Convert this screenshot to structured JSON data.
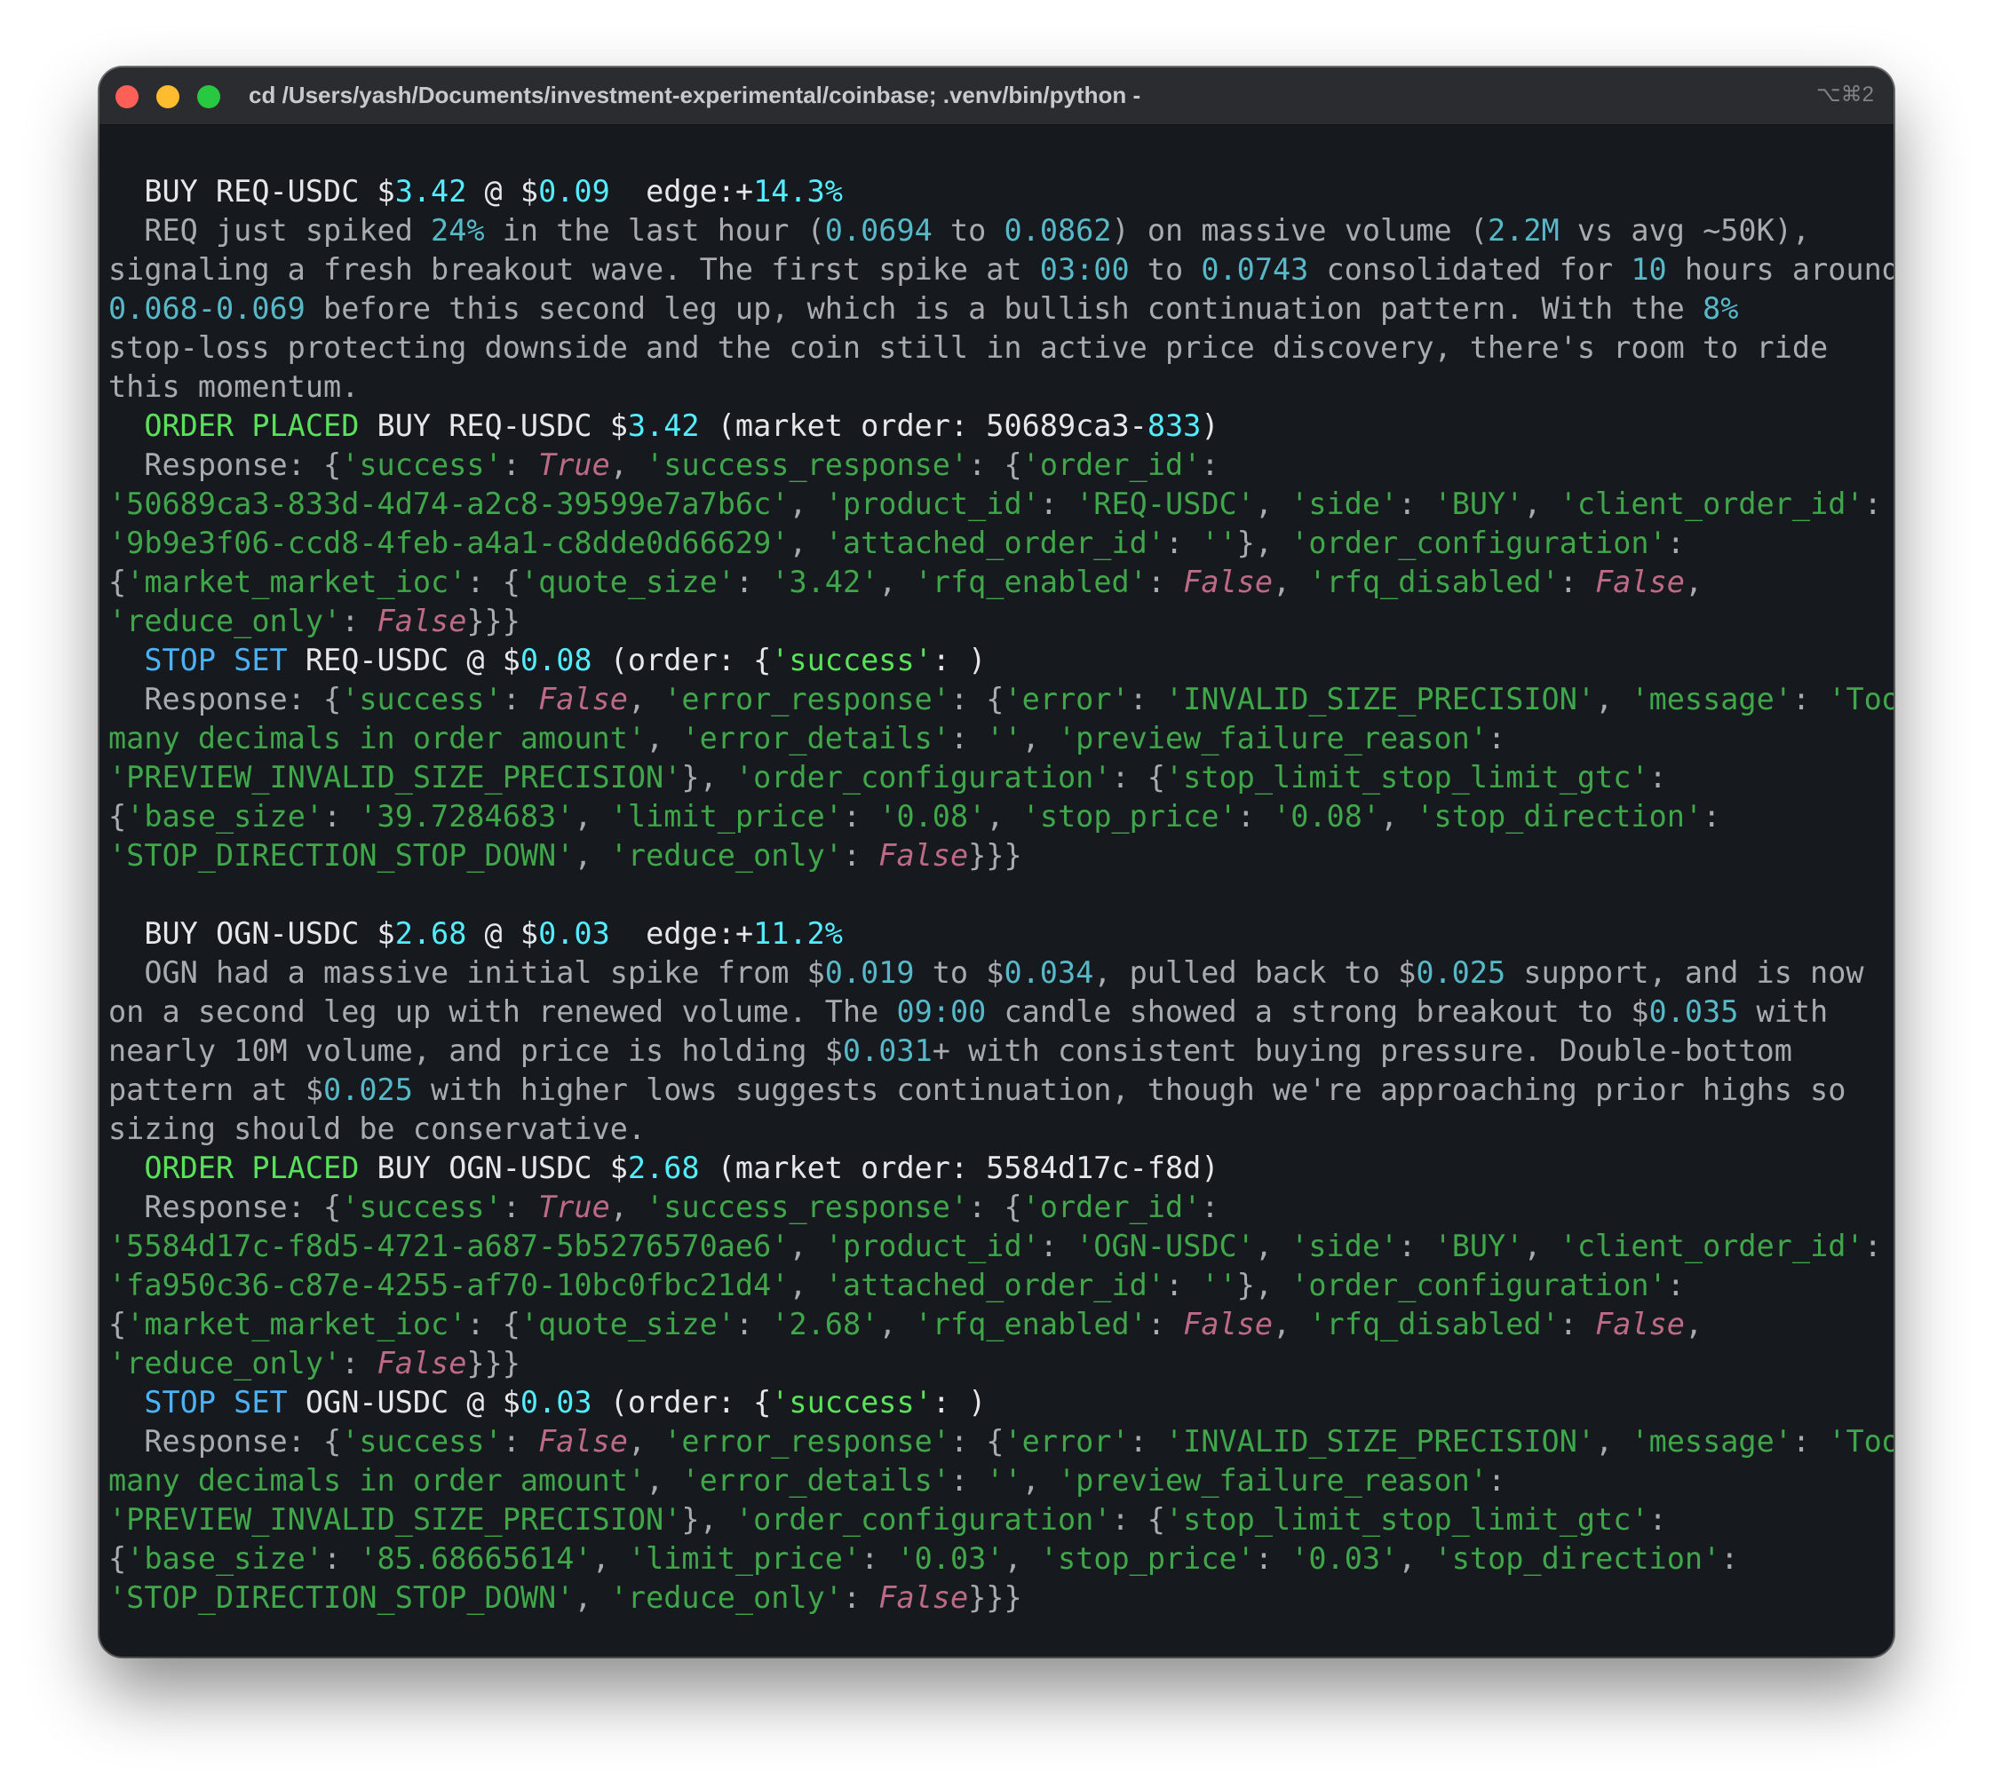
{
  "titlebar": {
    "title": "cd /Users/yash/Documents/investment-experimental/coinbase; .venv/bin/python -",
    "shortcut": "⌥⌘2"
  },
  "colors": {
    "terminal_bg": "#16191e",
    "text_gray": "#a8abb0",
    "text_white": "#e6e7ea",
    "cyan_bright": "#54ecff",
    "cyan_teal": "#57b9c8",
    "green_bright": "#5be05b",
    "string_green": "#3fa64a",
    "keyword_pink": "#bd6a84",
    "stop_blue": "#4bb3f5"
  },
  "output": [
    [
      {
        "t": "  BUY REQ-USDC $",
        "c": "w"
      },
      {
        "t": "3.42",
        "c": "c"
      },
      {
        "t": " @ $",
        "c": "w"
      },
      {
        "t": "0.09",
        "c": "c"
      },
      {
        "t": "  edge:+",
        "c": "w"
      },
      {
        "t": "14.3%",
        "c": "c"
      }
    ],
    [
      {
        "t": "  REQ just spiked ",
        "c": "dim"
      },
      {
        "t": "24%",
        "c": "tc"
      },
      {
        "t": " in the last hour (",
        "c": "dim"
      },
      {
        "t": "0.0694",
        "c": "tc"
      },
      {
        "t": " to ",
        "c": "dim"
      },
      {
        "t": "0.0862",
        "c": "tc"
      },
      {
        "t": ") on massive volume (",
        "c": "dim"
      },
      {
        "t": "2.2M",
        "c": "tc"
      },
      {
        "t": " vs avg ~50K),",
        "c": "dim"
      }
    ],
    [
      {
        "t": "signaling a fresh breakout wave. The first spike at ",
        "c": "dim"
      },
      {
        "t": "03:00",
        "c": "tc"
      },
      {
        "t": " to ",
        "c": "dim"
      },
      {
        "t": "0.0743",
        "c": "tc"
      },
      {
        "t": " consolidated for ",
        "c": "dim"
      },
      {
        "t": "10",
        "c": "tc"
      },
      {
        "t": " hours around",
        "c": "dim"
      }
    ],
    [
      {
        "t": "0.068-0.069",
        "c": "tc"
      },
      {
        "t": " before this second leg up, which is a bullish continuation pattern. With the ",
        "c": "dim"
      },
      {
        "t": "8%",
        "c": "tc"
      }
    ],
    [
      {
        "t": "stop-loss protecting downside and the coin still in active price discovery, there's room to ride",
        "c": "dim"
      }
    ],
    [
      {
        "t": "this momentum.",
        "c": "dim"
      }
    ],
    [
      {
        "t": "  ORDER PLACED",
        "c": "g"
      },
      {
        "t": " BUY REQ-USDC $",
        "c": "w"
      },
      {
        "t": "3.42",
        "c": "c"
      },
      {
        "t": " (market order: 50689ca3-",
        "c": "w"
      },
      {
        "t": "833",
        "c": "c"
      },
      {
        "t": ")",
        "c": "w"
      }
    ],
    [
      {
        "t": "  Response: {",
        "c": "dim"
      },
      {
        "t": "'success'",
        "c": "sg"
      },
      {
        "t": ": ",
        "c": "dim"
      },
      {
        "t": "True",
        "c": "kw"
      },
      {
        "t": ", ",
        "c": "dim"
      },
      {
        "t": "'success_response'",
        "c": "sg"
      },
      {
        "t": ": {",
        "c": "dim"
      },
      {
        "t": "'order_id'",
        "c": "sg"
      },
      {
        "t": ":",
        "c": "dim"
      }
    ],
    [
      {
        "t": "'50689ca3-833d-4d74-a2c8-39599e7a7b6c'",
        "c": "sg"
      },
      {
        "t": ", ",
        "c": "dim"
      },
      {
        "t": "'product_id'",
        "c": "sg"
      },
      {
        "t": ": ",
        "c": "dim"
      },
      {
        "t": "'REQ-USDC'",
        "c": "sg"
      },
      {
        "t": ", ",
        "c": "dim"
      },
      {
        "t": "'side'",
        "c": "sg"
      },
      {
        "t": ": ",
        "c": "dim"
      },
      {
        "t": "'BUY'",
        "c": "sg"
      },
      {
        "t": ", ",
        "c": "dim"
      },
      {
        "t": "'client_order_id'",
        "c": "sg"
      },
      {
        "t": ":",
        "c": "dim"
      }
    ],
    [
      {
        "t": "'9b9e3f06-ccd8-4feb-a4a1-c8dde0d66629'",
        "c": "sg"
      },
      {
        "t": ", ",
        "c": "dim"
      },
      {
        "t": "'attached_order_id'",
        "c": "sg"
      },
      {
        "t": ": ",
        "c": "dim"
      },
      {
        "t": "''",
        "c": "sg"
      },
      {
        "t": "}, ",
        "c": "dim"
      },
      {
        "t": "'order_configuration'",
        "c": "sg"
      },
      {
        "t": ":",
        "c": "dim"
      }
    ],
    [
      {
        "t": "{",
        "c": "dim"
      },
      {
        "t": "'market_market_ioc'",
        "c": "sg"
      },
      {
        "t": ": {",
        "c": "dim"
      },
      {
        "t": "'quote_size'",
        "c": "sg"
      },
      {
        "t": ": ",
        "c": "dim"
      },
      {
        "t": "'3.42'",
        "c": "sg"
      },
      {
        "t": ", ",
        "c": "dim"
      },
      {
        "t": "'rfq_enabled'",
        "c": "sg"
      },
      {
        "t": ": ",
        "c": "dim"
      },
      {
        "t": "False",
        "c": "kw"
      },
      {
        "t": ", ",
        "c": "dim"
      },
      {
        "t": "'rfq_disabled'",
        "c": "sg"
      },
      {
        "t": ": ",
        "c": "dim"
      },
      {
        "t": "False",
        "c": "kw"
      },
      {
        "t": ",",
        "c": "dim"
      }
    ],
    [
      {
        "t": "'reduce_only'",
        "c": "sg"
      },
      {
        "t": ": ",
        "c": "dim"
      },
      {
        "t": "False",
        "c": "kw"
      },
      {
        "t": "}}}",
        "c": "dim"
      }
    ],
    [
      {
        "t": "  STOP SET",
        "c": "b"
      },
      {
        "t": " REQ-USDC @ $",
        "c": "w"
      },
      {
        "t": "0.08",
        "c": "c"
      },
      {
        "t": " (order: {",
        "c": "w"
      },
      {
        "t": "'success'",
        "c": "g"
      },
      {
        "t": ": )",
        "c": "w"
      }
    ],
    [
      {
        "t": "  Response: {",
        "c": "dim"
      },
      {
        "t": "'success'",
        "c": "sg"
      },
      {
        "t": ": ",
        "c": "dim"
      },
      {
        "t": "False",
        "c": "kw"
      },
      {
        "t": ", ",
        "c": "dim"
      },
      {
        "t": "'error_response'",
        "c": "sg"
      },
      {
        "t": ": {",
        "c": "dim"
      },
      {
        "t": "'error'",
        "c": "sg"
      },
      {
        "t": ": ",
        "c": "dim"
      },
      {
        "t": "'INVALID_SIZE_PRECISION'",
        "c": "sg"
      },
      {
        "t": ", ",
        "c": "dim"
      },
      {
        "t": "'message'",
        "c": "sg"
      },
      {
        "t": ": ",
        "c": "dim"
      },
      {
        "t": "'Too",
        "c": "sg"
      }
    ],
    [
      {
        "t": "many decimals in order amount'",
        "c": "sg"
      },
      {
        "t": ", ",
        "c": "dim"
      },
      {
        "t": "'error_details'",
        "c": "sg"
      },
      {
        "t": ": ",
        "c": "dim"
      },
      {
        "t": "''",
        "c": "sg"
      },
      {
        "t": ", ",
        "c": "dim"
      },
      {
        "t": "'preview_failure_reason'",
        "c": "sg"
      },
      {
        "t": ":",
        "c": "dim"
      }
    ],
    [
      {
        "t": "'PREVIEW_INVALID_SIZE_PRECISION'",
        "c": "sg"
      },
      {
        "t": "}, ",
        "c": "dim"
      },
      {
        "t": "'order_configuration'",
        "c": "sg"
      },
      {
        "t": ": {",
        "c": "dim"
      },
      {
        "t": "'stop_limit_stop_limit_gtc'",
        "c": "sg"
      },
      {
        "t": ":",
        "c": "dim"
      }
    ],
    [
      {
        "t": "{",
        "c": "dim"
      },
      {
        "t": "'base_size'",
        "c": "sg"
      },
      {
        "t": ": ",
        "c": "dim"
      },
      {
        "t": "'39.7284683'",
        "c": "sg"
      },
      {
        "t": ", ",
        "c": "dim"
      },
      {
        "t": "'limit_price'",
        "c": "sg"
      },
      {
        "t": ": ",
        "c": "dim"
      },
      {
        "t": "'0.08'",
        "c": "sg"
      },
      {
        "t": ", ",
        "c": "dim"
      },
      {
        "t": "'stop_price'",
        "c": "sg"
      },
      {
        "t": ": ",
        "c": "dim"
      },
      {
        "t": "'0.08'",
        "c": "sg"
      },
      {
        "t": ", ",
        "c": "dim"
      },
      {
        "t": "'stop_direction'",
        "c": "sg"
      },
      {
        "t": ":",
        "c": "dim"
      }
    ],
    [
      {
        "t": "'STOP_DIRECTION_STOP_DOWN'",
        "c": "sg"
      },
      {
        "t": ", ",
        "c": "dim"
      },
      {
        "t": "'reduce_only'",
        "c": "sg"
      },
      {
        "t": ": ",
        "c": "dim"
      },
      {
        "t": "False",
        "c": "kw"
      },
      {
        "t": "}}}",
        "c": "dim"
      }
    ],
    [
      {
        "t": "",
        "c": "dim"
      }
    ],
    [
      {
        "t": "  BUY OGN-USDC $",
        "c": "w"
      },
      {
        "t": "2.68",
        "c": "c"
      },
      {
        "t": " @ $",
        "c": "w"
      },
      {
        "t": "0.03",
        "c": "c"
      },
      {
        "t": "  edge:+",
        "c": "w"
      },
      {
        "t": "11.2%",
        "c": "c"
      }
    ],
    [
      {
        "t": "  OGN had a massive initial spike from $",
        "c": "dim"
      },
      {
        "t": "0.019",
        "c": "tc"
      },
      {
        "t": " to $",
        "c": "dim"
      },
      {
        "t": "0.034",
        "c": "tc"
      },
      {
        "t": ", pulled back to $",
        "c": "dim"
      },
      {
        "t": "0.025",
        "c": "tc"
      },
      {
        "t": " support, and is now",
        "c": "dim"
      }
    ],
    [
      {
        "t": "on a second leg up with renewed volume. The ",
        "c": "dim"
      },
      {
        "t": "09:00",
        "c": "tc"
      },
      {
        "t": " candle showed a strong breakout to $",
        "c": "dim"
      },
      {
        "t": "0.035",
        "c": "tc"
      },
      {
        "t": " with",
        "c": "dim"
      }
    ],
    [
      {
        "t": "nearly 10M volume, and price is holding $",
        "c": "dim"
      },
      {
        "t": "0.031",
        "c": "tc"
      },
      {
        "t": "+ with consistent buying pressure. Double-bottom",
        "c": "dim"
      }
    ],
    [
      {
        "t": "pattern at $",
        "c": "dim"
      },
      {
        "t": "0.025",
        "c": "tc"
      },
      {
        "t": " with higher lows suggests continuation, though we're approaching prior highs so",
        "c": "dim"
      }
    ],
    [
      {
        "t": "sizing should be conservative.",
        "c": "dim"
      }
    ],
    [
      {
        "t": "  ORDER PLACED",
        "c": "g"
      },
      {
        "t": " BUY OGN-USDC $",
        "c": "w"
      },
      {
        "t": "2.68",
        "c": "c"
      },
      {
        "t": " (market order: 5584d17c-f8d)",
        "c": "w"
      }
    ],
    [
      {
        "t": "  Response: {",
        "c": "dim"
      },
      {
        "t": "'success'",
        "c": "sg"
      },
      {
        "t": ": ",
        "c": "dim"
      },
      {
        "t": "True",
        "c": "kw"
      },
      {
        "t": ", ",
        "c": "dim"
      },
      {
        "t": "'success_response'",
        "c": "sg"
      },
      {
        "t": ": {",
        "c": "dim"
      },
      {
        "t": "'order_id'",
        "c": "sg"
      },
      {
        "t": ":",
        "c": "dim"
      }
    ],
    [
      {
        "t": "'5584d17c-f8d5-4721-a687-5b5276570ae6'",
        "c": "sg"
      },
      {
        "t": ", ",
        "c": "dim"
      },
      {
        "t": "'product_id'",
        "c": "sg"
      },
      {
        "t": ": ",
        "c": "dim"
      },
      {
        "t": "'OGN-USDC'",
        "c": "sg"
      },
      {
        "t": ", ",
        "c": "dim"
      },
      {
        "t": "'side'",
        "c": "sg"
      },
      {
        "t": ": ",
        "c": "dim"
      },
      {
        "t": "'BUY'",
        "c": "sg"
      },
      {
        "t": ", ",
        "c": "dim"
      },
      {
        "t": "'client_order_id'",
        "c": "sg"
      },
      {
        "t": ":",
        "c": "dim"
      }
    ],
    [
      {
        "t": "'fa950c36-c87e-4255-af70-10bc0fbc21d4'",
        "c": "sg"
      },
      {
        "t": ", ",
        "c": "dim"
      },
      {
        "t": "'attached_order_id'",
        "c": "sg"
      },
      {
        "t": ": ",
        "c": "dim"
      },
      {
        "t": "''",
        "c": "sg"
      },
      {
        "t": "}, ",
        "c": "dim"
      },
      {
        "t": "'order_configuration'",
        "c": "sg"
      },
      {
        "t": ":",
        "c": "dim"
      }
    ],
    [
      {
        "t": "{",
        "c": "dim"
      },
      {
        "t": "'market_market_ioc'",
        "c": "sg"
      },
      {
        "t": ": {",
        "c": "dim"
      },
      {
        "t": "'quote_size'",
        "c": "sg"
      },
      {
        "t": ": ",
        "c": "dim"
      },
      {
        "t": "'2.68'",
        "c": "sg"
      },
      {
        "t": ", ",
        "c": "dim"
      },
      {
        "t": "'rfq_enabled'",
        "c": "sg"
      },
      {
        "t": ": ",
        "c": "dim"
      },
      {
        "t": "False",
        "c": "kw"
      },
      {
        "t": ", ",
        "c": "dim"
      },
      {
        "t": "'rfq_disabled'",
        "c": "sg"
      },
      {
        "t": ": ",
        "c": "dim"
      },
      {
        "t": "False",
        "c": "kw"
      },
      {
        "t": ",",
        "c": "dim"
      }
    ],
    [
      {
        "t": "'reduce_only'",
        "c": "sg"
      },
      {
        "t": ": ",
        "c": "dim"
      },
      {
        "t": "False",
        "c": "kw"
      },
      {
        "t": "}}}",
        "c": "dim"
      }
    ],
    [
      {
        "t": "  STOP SET",
        "c": "b"
      },
      {
        "t": " OGN-USDC @ $",
        "c": "w"
      },
      {
        "t": "0.03",
        "c": "c"
      },
      {
        "t": " (order: {",
        "c": "w"
      },
      {
        "t": "'success'",
        "c": "g"
      },
      {
        "t": ": )",
        "c": "w"
      }
    ],
    [
      {
        "t": "  Response: {",
        "c": "dim"
      },
      {
        "t": "'success'",
        "c": "sg"
      },
      {
        "t": ": ",
        "c": "dim"
      },
      {
        "t": "False",
        "c": "kw"
      },
      {
        "t": ", ",
        "c": "dim"
      },
      {
        "t": "'error_response'",
        "c": "sg"
      },
      {
        "t": ": {",
        "c": "dim"
      },
      {
        "t": "'error'",
        "c": "sg"
      },
      {
        "t": ": ",
        "c": "dim"
      },
      {
        "t": "'INVALID_SIZE_PRECISION'",
        "c": "sg"
      },
      {
        "t": ", ",
        "c": "dim"
      },
      {
        "t": "'message'",
        "c": "sg"
      },
      {
        "t": ": ",
        "c": "dim"
      },
      {
        "t": "'Too",
        "c": "sg"
      }
    ],
    [
      {
        "t": "many decimals in order amount'",
        "c": "sg"
      },
      {
        "t": ", ",
        "c": "dim"
      },
      {
        "t": "'error_details'",
        "c": "sg"
      },
      {
        "t": ": ",
        "c": "dim"
      },
      {
        "t": "''",
        "c": "sg"
      },
      {
        "t": ", ",
        "c": "dim"
      },
      {
        "t": "'preview_failure_reason'",
        "c": "sg"
      },
      {
        "t": ":",
        "c": "dim"
      }
    ],
    [
      {
        "t": "'PREVIEW_INVALID_SIZE_PRECISION'",
        "c": "sg"
      },
      {
        "t": "}, ",
        "c": "dim"
      },
      {
        "t": "'order_configuration'",
        "c": "sg"
      },
      {
        "t": ": {",
        "c": "dim"
      },
      {
        "t": "'stop_limit_stop_limit_gtc'",
        "c": "sg"
      },
      {
        "t": ":",
        "c": "dim"
      }
    ],
    [
      {
        "t": "{",
        "c": "dim"
      },
      {
        "t": "'base_size'",
        "c": "sg"
      },
      {
        "t": ": ",
        "c": "dim"
      },
      {
        "t": "'85.68665614'",
        "c": "sg"
      },
      {
        "t": ", ",
        "c": "dim"
      },
      {
        "t": "'limit_price'",
        "c": "sg"
      },
      {
        "t": ": ",
        "c": "dim"
      },
      {
        "t": "'0.03'",
        "c": "sg"
      },
      {
        "t": ", ",
        "c": "dim"
      },
      {
        "t": "'stop_price'",
        "c": "sg"
      },
      {
        "t": ": ",
        "c": "dim"
      },
      {
        "t": "'0.03'",
        "c": "sg"
      },
      {
        "t": ", ",
        "c": "dim"
      },
      {
        "t": "'stop_direction'",
        "c": "sg"
      },
      {
        "t": ":",
        "c": "dim"
      }
    ],
    [
      {
        "t": "'STOP_DIRECTION_STOP_DOWN'",
        "c": "sg"
      },
      {
        "t": ", ",
        "c": "dim"
      },
      {
        "t": "'reduce_only'",
        "c": "sg"
      },
      {
        "t": ": ",
        "c": "dim"
      },
      {
        "t": "False",
        "c": "kw"
      },
      {
        "t": "}}}",
        "c": "dim"
      }
    ]
  ]
}
